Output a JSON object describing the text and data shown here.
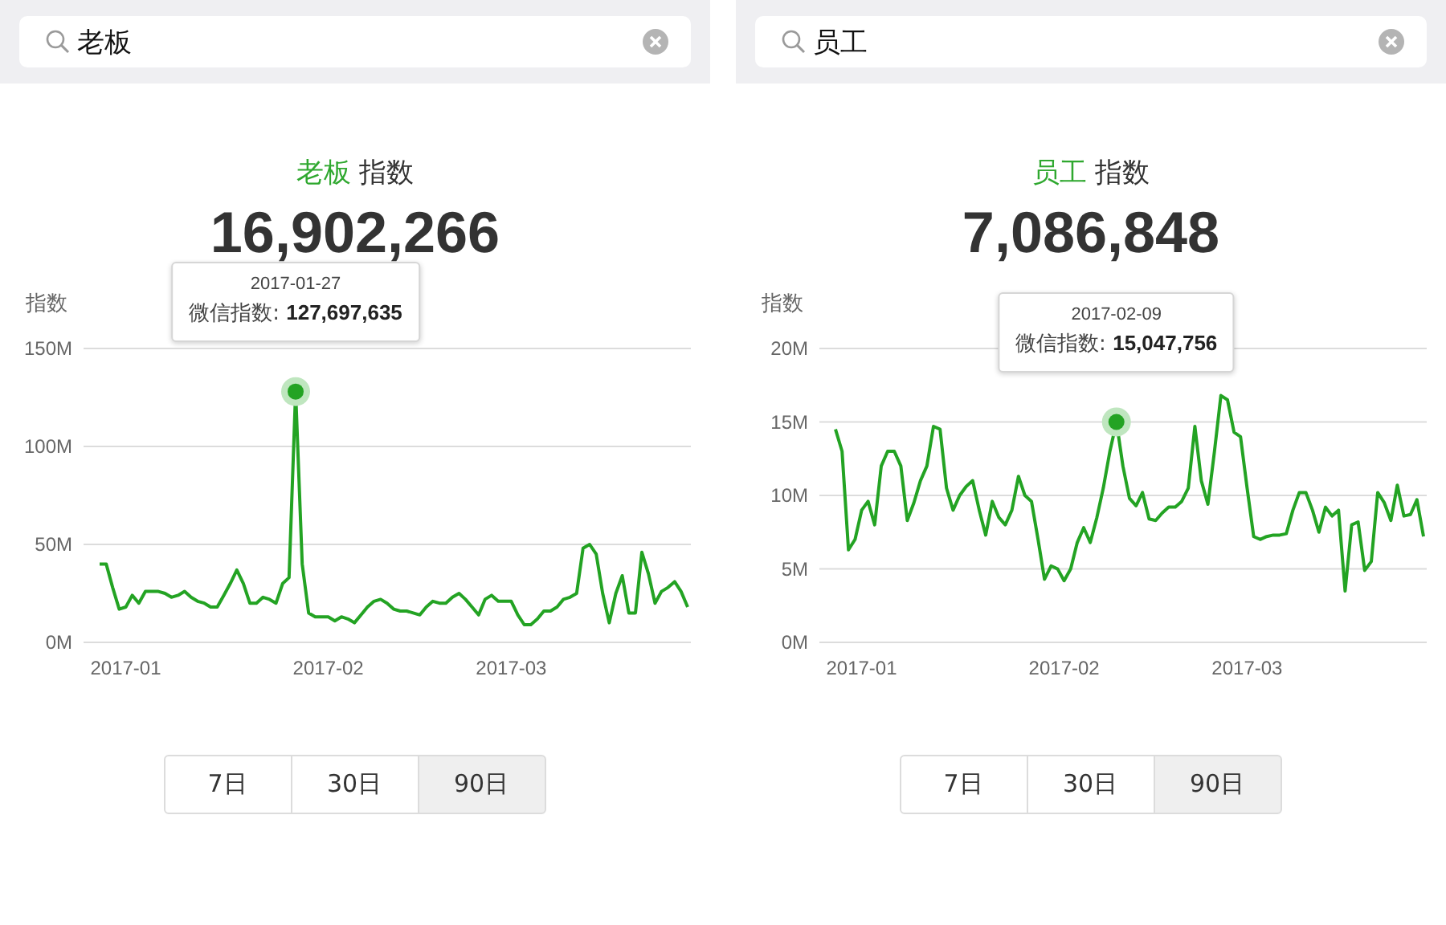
{
  "panels": [
    {
      "search": {
        "value": "老板"
      },
      "keyword": "老板",
      "title_suffix": "指数",
      "total": "16,902,266",
      "chart_data": {
        "type": "line",
        "ylabel": "指数",
        "categories": [
          null,
          null,
          null,
          null,
          "2017-01",
          null,
          null,
          null,
          null,
          null,
          null,
          null,
          null,
          null,
          null,
          null,
          null,
          null,
          null,
          null,
          null,
          null,
          null,
          null,
          null,
          null,
          null,
          null,
          null,
          null,
          null,
          null,
          null,
          null,
          null,
          "2017-02",
          null,
          null,
          null,
          null,
          null,
          null,
          null,
          null,
          null,
          null,
          null,
          null,
          null,
          null,
          null,
          null,
          null,
          null,
          null,
          null,
          null,
          null,
          null,
          null,
          null,
          null,
          null,
          "2017-03",
          null,
          null,
          null,
          null,
          null,
          null,
          null,
          null,
          null,
          null,
          null,
          null,
          null,
          null,
          null,
          null,
          null,
          null,
          null,
          null,
          null,
          null,
          null,
          null,
          null,
          null,
          null
        ],
        "ylim": [
          0,
          150
        ],
        "grid": true,
        "yticks": [
          {
            "value": 0,
            "label": "0M"
          },
          {
            "value": 50,
            "label": "50M"
          },
          {
            "value": 100,
            "label": "100M"
          },
          {
            "value": 150,
            "label": "150M"
          }
        ],
        "series": [
          {
            "color": "#23a323",
            "values": [
              40,
              40,
              28,
              17,
              18,
              24,
              20,
              26,
              26,
              26,
              25,
              23,
              24,
              26,
              23,
              21,
              20,
              18,
              18,
              24,
              30,
              37,
              30,
              20,
              20,
              23,
              22,
              20,
              30,
              33,
              128,
              40,
              15,
              13,
              13,
              13,
              11,
              13,
              12,
              10,
              14,
              18,
              21,
              22,
              20,
              17,
              16,
              16,
              15,
              14,
              18,
              21,
              20,
              20,
              23,
              25,
              22,
              18,
              14,
              22,
              24,
              21,
              21,
              21,
              14,
              9,
              9,
              12,
              16,
              16,
              18,
              22,
              23,
              25,
              48,
              50,
              45,
              25,
              10,
              25,
              34,
              15,
              15,
              46,
              35,
              20,
              26,
              28,
              31,
              26,
              18
            ]
          },
          {
            "marker": true,
            "color": "#23a323",
            "values": [
              null,
              null,
              null,
              null,
              null,
              null,
              null,
              null,
              null,
              null,
              null,
              null,
              null,
              null,
              null,
              null,
              null,
              null,
              null,
              null,
              null,
              null,
              null,
              null,
              null,
              null,
              null,
              null,
              null,
              null,
              128,
              null,
              null,
              null,
              null,
              null,
              null,
              null,
              null,
              null,
              null,
              null,
              null,
              null,
              null,
              null,
              null,
              null,
              null,
              null,
              null,
              null,
              null,
              null,
              null,
              null,
              null,
              null,
              null,
              null,
              null,
              null,
              null,
              null,
              null,
              null,
              null,
              null,
              null,
              null,
              null,
              null,
              null,
              null,
              null,
              null,
              null,
              null,
              null,
              null,
              null,
              null,
              null,
              null,
              null,
              null,
              null,
              null,
              null,
              null,
              null
            ]
          }
        ]
      },
      "tooltip": {
        "date": "2017-01-27",
        "label": "微信指数:",
        "value": "127,697,635"
      },
      "ranges": [
        {
          "label": "7日",
          "selected": false
        },
        {
          "label": "30日",
          "selected": false
        },
        {
          "label": "90日",
          "selected": true
        }
      ]
    },
    {
      "search": {
        "value": "员工"
      },
      "keyword": "员工",
      "title_suffix": "指数",
      "total": "7,086,848",
      "chart_data": {
        "type": "line",
        "ylabel": "指数",
        "categories": [
          null,
          null,
          null,
          null,
          "2017-01",
          null,
          null,
          null,
          null,
          null,
          null,
          null,
          null,
          null,
          null,
          null,
          null,
          null,
          null,
          null,
          null,
          null,
          null,
          null,
          null,
          null,
          null,
          null,
          null,
          null,
          null,
          null,
          null,
          null,
          null,
          "2017-02",
          null,
          null,
          null,
          null,
          null,
          null,
          null,
          null,
          null,
          null,
          null,
          null,
          null,
          null,
          null,
          null,
          null,
          null,
          null,
          null,
          null,
          null,
          null,
          null,
          null,
          null,
          null,
          "2017-03",
          null,
          null,
          null,
          null,
          null,
          null,
          null,
          null,
          null,
          null,
          null,
          null,
          null,
          null,
          null,
          null,
          null,
          null,
          null,
          null,
          null,
          null,
          null,
          null,
          null,
          null,
          null
        ],
        "ylim": [
          0,
          20
        ],
        "grid": true,
        "yticks": [
          {
            "value": 0,
            "label": "0M"
          },
          {
            "value": 5,
            "label": "5M"
          },
          {
            "value": 10,
            "label": "10M"
          },
          {
            "value": 15,
            "label": "15M"
          },
          {
            "value": 20,
            "label": "20M"
          }
        ],
        "series": [
          {
            "color": "#23a323",
            "values": [
              14.5,
              13,
              6.3,
              7,
              9,
              9.6,
              8,
              12,
              13,
              13,
              12,
              8.3,
              9.5,
              11,
              12,
              14.7,
              14.5,
              10.5,
              9,
              10,
              10.6,
              11,
              9,
              7.3,
              9.6,
              8.5,
              8,
              9,
              11.3,
              10,
              9.6,
              7,
              4.3,
              5.2,
              5,
              4.2,
              5,
              6.8,
              7.8,
              6.8,
              8.5,
              10.5,
              13,
              15,
              12,
              9.8,
              9.3,
              10.2,
              8.4,
              8.3,
              8.8,
              9.2,
              9.2,
              9.6,
              10.5,
              14.7,
              11,
              9.4,
              13,
              16.8,
              16.5,
              14.3,
              14,
              10.5,
              7.2,
              7,
              7.2,
              7.3,
              7.3,
              7.4,
              9,
              10.2,
              10.2,
              9,
              7.5,
              9.2,
              8.6,
              9,
              3.5,
              8,
              8.2,
              4.9,
              5.5,
              10.2,
              9.5,
              8.3,
              10.7,
              8.6,
              8.7,
              9.7,
              7.2
            ]
          },
          {
            "marker": true,
            "color": "#23a323",
            "values": [
              null,
              null,
              null,
              null,
              null,
              null,
              null,
              null,
              null,
              null,
              null,
              null,
              null,
              null,
              null,
              null,
              null,
              null,
              null,
              null,
              null,
              null,
              null,
              null,
              null,
              null,
              null,
              null,
              null,
              null,
              null,
              null,
              null,
              null,
              null,
              null,
              null,
              null,
              null,
              null,
              null,
              null,
              null,
              15,
              null,
              null,
              null,
              null,
              null,
              null,
              null,
              null,
              null,
              null,
              null,
              null,
              null,
              null,
              null,
              null,
              null,
              null,
              null,
              null,
              null,
              null,
              null,
              null,
              null,
              null,
              null,
              null,
              null,
              null,
              null,
              null,
              null,
              null,
              null,
              null,
              null,
              null,
              null,
              null,
              null,
              null,
              null,
              null,
              null,
              null,
              null
            ]
          }
        ]
      },
      "tooltip": {
        "date": "2017-02-09",
        "label": "微信指数:",
        "value": "15,047,756"
      },
      "ranges": [
        {
          "label": "7日",
          "selected": false
        },
        {
          "label": "30日",
          "selected": false
        },
        {
          "label": "90日",
          "selected": true
        }
      ]
    }
  ]
}
